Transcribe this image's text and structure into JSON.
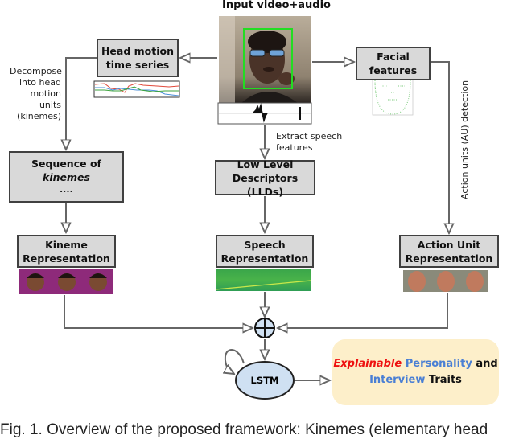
{
  "diagram": {
    "input_title": "Input video+audio",
    "nodes": {
      "head_motion": "Head motion time series",
      "head_motion_l1": "Head motion",
      "head_motion_l2": "time series",
      "facial_l1": "Facial",
      "facial_l2": "features",
      "seq_prefix": "Sequence of ",
      "seq_italic": "kinemes",
      "seq_dots": "....",
      "lld_l1": "Low Level",
      "lld_l2": "Descriptors (LLDs)",
      "kineme_l1": "Kineme",
      "kineme_l2": "Representation",
      "speech_l1": "Speech",
      "speech_l2": "Representation",
      "au_l1": "Action Unit",
      "au_l2": "Representation",
      "lstm": "LSTM"
    },
    "edge_labels": {
      "decompose_l1": "Decompose",
      "decompose_l2": "into head",
      "decompose_l3": "motion units",
      "decompose_l4": "(kinemes)",
      "extract_l1": "Extract speech",
      "extract_l2": "features",
      "au_detection": "Action units (AU) detection"
    },
    "output": {
      "word1": "Explainable",
      "word2": "Personality",
      "word3": "and",
      "word4": "Interview",
      "word5": "Traits"
    },
    "colors": {
      "box_fill": "#d9d9d9",
      "output_fill": "#fdefca",
      "lstm_fill": "#cfe0f2",
      "explainable": "#ee1111",
      "highlight_blue": "#4a7fd4",
      "face_box": "#22dd22"
    }
  },
  "caption": "Fig. 1. Overview of the proposed framework: Kinemes (elementary head"
}
